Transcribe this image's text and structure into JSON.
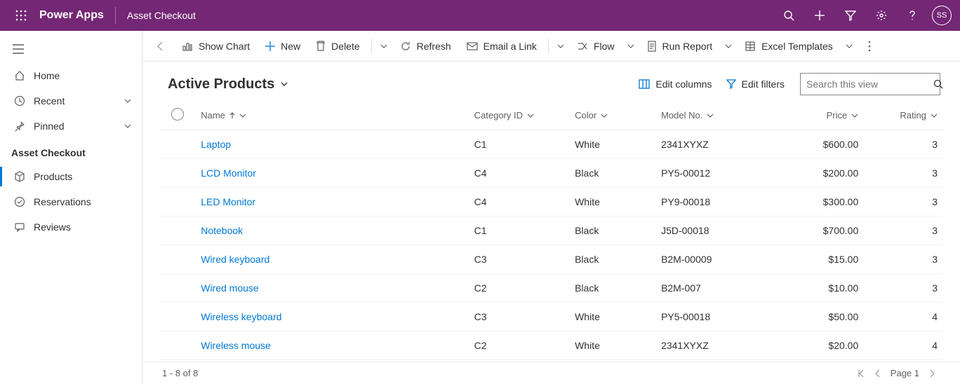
{
  "topbar": {
    "brand": "Power Apps",
    "appname": "Asset Checkout",
    "avatar": "SS"
  },
  "sidebar": {
    "home": "Home",
    "recent": "Recent",
    "pinned": "Pinned",
    "section": "Asset Checkout",
    "products": "Products",
    "reservations": "Reservations",
    "reviews": "Reviews"
  },
  "commands": {
    "showChart": "Show Chart",
    "new": "New",
    "delete": "Delete",
    "refresh": "Refresh",
    "emailLink": "Email a Link",
    "flow": "Flow",
    "runReport": "Run Report",
    "excelTemplates": "Excel Templates"
  },
  "view": {
    "title": "Active Products",
    "editColumns": "Edit columns",
    "editFilters": "Edit filters",
    "searchPlaceholder": "Search this view"
  },
  "columns": {
    "name": "Name",
    "category": "Category ID",
    "color": "Color",
    "model": "Model No.",
    "price": "Price",
    "rating": "Rating"
  },
  "rows": [
    {
      "name": "Laptop",
      "category": "C1",
      "color": "White",
      "model": "2341XYXZ",
      "price": "$600.00",
      "rating": "3"
    },
    {
      "name": "LCD Monitor",
      "category": "C4",
      "color": "Black",
      "model": "PY5-00012",
      "price": "$200.00",
      "rating": "3"
    },
    {
      "name": "LED Monitor",
      "category": "C4",
      "color": "White",
      "model": "PY9-00018",
      "price": "$300.00",
      "rating": "3"
    },
    {
      "name": "Notebook",
      "category": "C1",
      "color": "Black",
      "model": "J5D-00018",
      "price": "$700.00",
      "rating": "3"
    },
    {
      "name": "Wired keyboard",
      "category": "C3",
      "color": "Black",
      "model": "B2M-00009",
      "price": "$15.00",
      "rating": "3"
    },
    {
      "name": "Wired mouse",
      "category": "C2",
      "color": "Black",
      "model": "B2M-007",
      "price": "$10.00",
      "rating": "3"
    },
    {
      "name": "Wireless keyboard",
      "category": "C3",
      "color": "White",
      "model": "PY5-00018",
      "price": "$50.00",
      "rating": "4"
    },
    {
      "name": "Wireless mouse",
      "category": "C2",
      "color": "White",
      "model": "2341XYXZ",
      "price": "$20.00",
      "rating": "4"
    }
  ],
  "footer": {
    "count": "1 - 8 of 8",
    "page": "Page 1"
  }
}
